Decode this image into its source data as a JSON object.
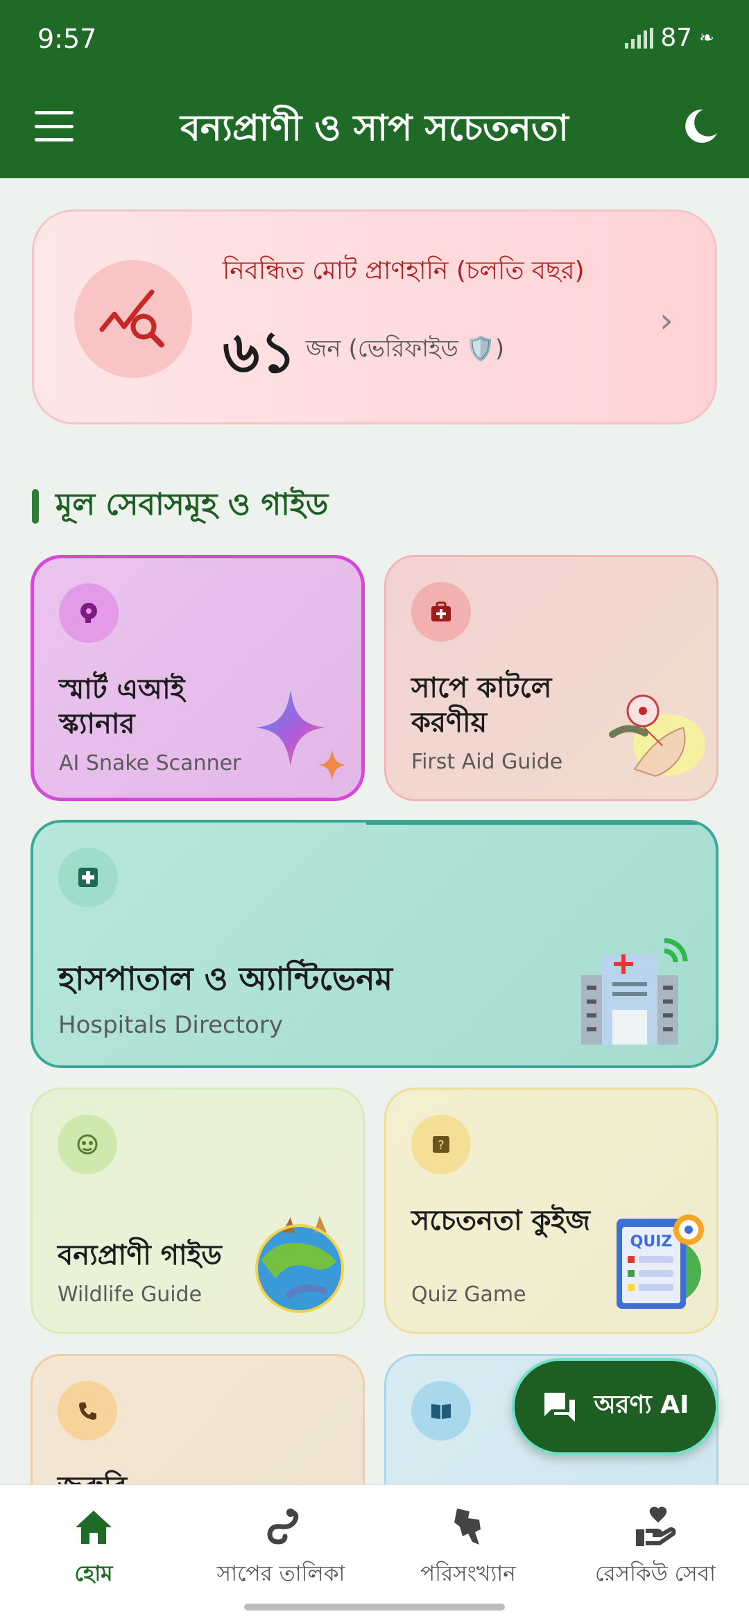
{
  "status_bar": {
    "time": "9:57",
    "battery": "87"
  },
  "app_bar": {
    "title": "বন্যপ্রাণী ও সাপ সচেতনতা"
  },
  "stat_card": {
    "label": "নিবন্ধিত মোট প্রাণহানি (চলতি বছর)",
    "value": "৬১",
    "unit": "জন (ভেরিফাইড 🛡️)"
  },
  "section": {
    "title": "মূল সেবাসমূহ ও গাইড"
  },
  "cards": {
    "ai_scanner": {
      "title_bn": "স্মার্ট এআই স্ক্যানার",
      "title_en": "AI Snake Scanner"
    },
    "first_aid": {
      "title_bn": "সাপে কাটলে করণীয়",
      "title_en": "First Aid Guide"
    },
    "hospitals": {
      "title_bn": "হাসপাতাল ও অ্যান্টিভেনম",
      "title_en": "Hospitals Directory"
    },
    "wildlife": {
      "title_bn": "বন্যপ্রাণী গাইড",
      "title_en": "Wildlife Guide"
    },
    "quiz": {
      "title_bn": "সচেতনতা কুইজ",
      "title_en": "Quiz Game",
      "art_text": "QUIZ"
    },
    "emergency": {
      "title_bn": "জরুরি"
    }
  },
  "fab": {
    "label": "অরণ্য AI"
  },
  "bottom_nav": {
    "items": [
      {
        "label": "হোম",
        "icon": "home-icon",
        "active": true
      },
      {
        "label": "সাপের তালিকা",
        "icon": "snake-icon",
        "active": false
      },
      {
        "label": "পরিসংখ্যান",
        "icon": "bangladesh-map-icon",
        "active": false
      },
      {
        "label": "রেসকিউ সেবা",
        "icon": "rescue-hand-heart-icon",
        "active": false
      }
    ]
  },
  "colors": {
    "primary": "#1f6a26",
    "danger": "#b41d1d",
    "fab_border": "#6fe0c6"
  }
}
